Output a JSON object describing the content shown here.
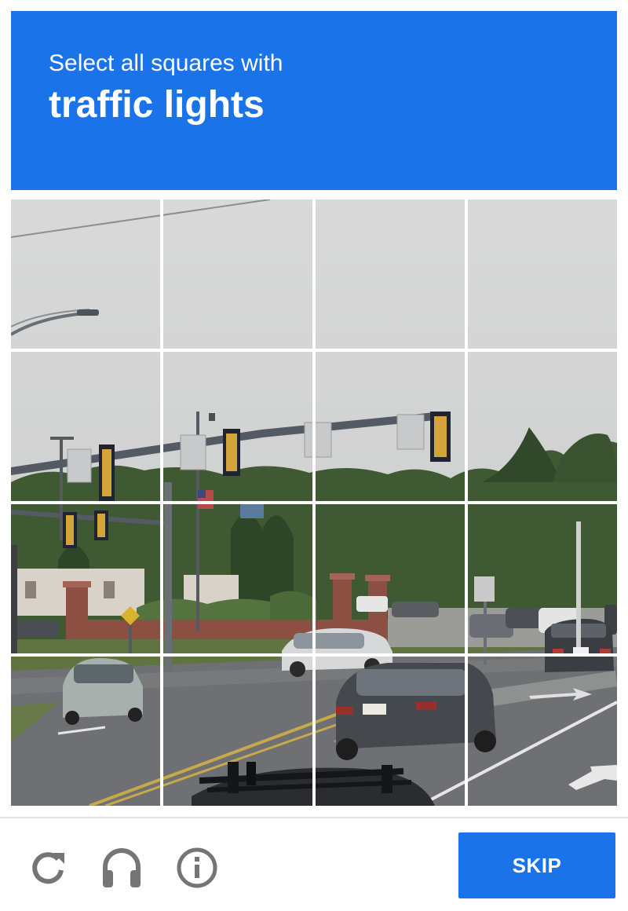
{
  "header": {
    "instruction": "Select all squares with",
    "target": "traffic lights",
    "background_color": "#1a73e8"
  },
  "grid": {
    "rows": 4,
    "columns": 4,
    "tiles": [
      {
        "row": 1,
        "col": 1,
        "selected": false
      },
      {
        "row": 1,
        "col": 2,
        "selected": false
      },
      {
        "row": 1,
        "col": 3,
        "selected": false
      },
      {
        "row": 1,
        "col": 4,
        "selected": false
      },
      {
        "row": 2,
        "col": 1,
        "selected": false
      },
      {
        "row": 2,
        "col": 2,
        "selected": false
      },
      {
        "row": 2,
        "col": 3,
        "selected": false
      },
      {
        "row": 2,
        "col": 4,
        "selected": false
      },
      {
        "row": 3,
        "col": 1,
        "selected": false
      },
      {
        "row": 3,
        "col": 2,
        "selected": false
      },
      {
        "row": 3,
        "col": 3,
        "selected": false
      },
      {
        "row": 3,
        "col": 4,
        "selected": false
      },
      {
        "row": 4,
        "col": 1,
        "selected": false
      },
      {
        "row": 4,
        "col": 2,
        "selected": false
      },
      {
        "row": 4,
        "col": 3,
        "selected": false
      },
      {
        "row": 4,
        "col": 4,
        "selected": false
      }
    ]
  },
  "footer": {
    "icons": [
      "reload-icon",
      "headphones-icon",
      "info-icon"
    ],
    "skip_label": "SKIP",
    "accent_color": "#1a73e8",
    "icon_color": "#757575"
  }
}
